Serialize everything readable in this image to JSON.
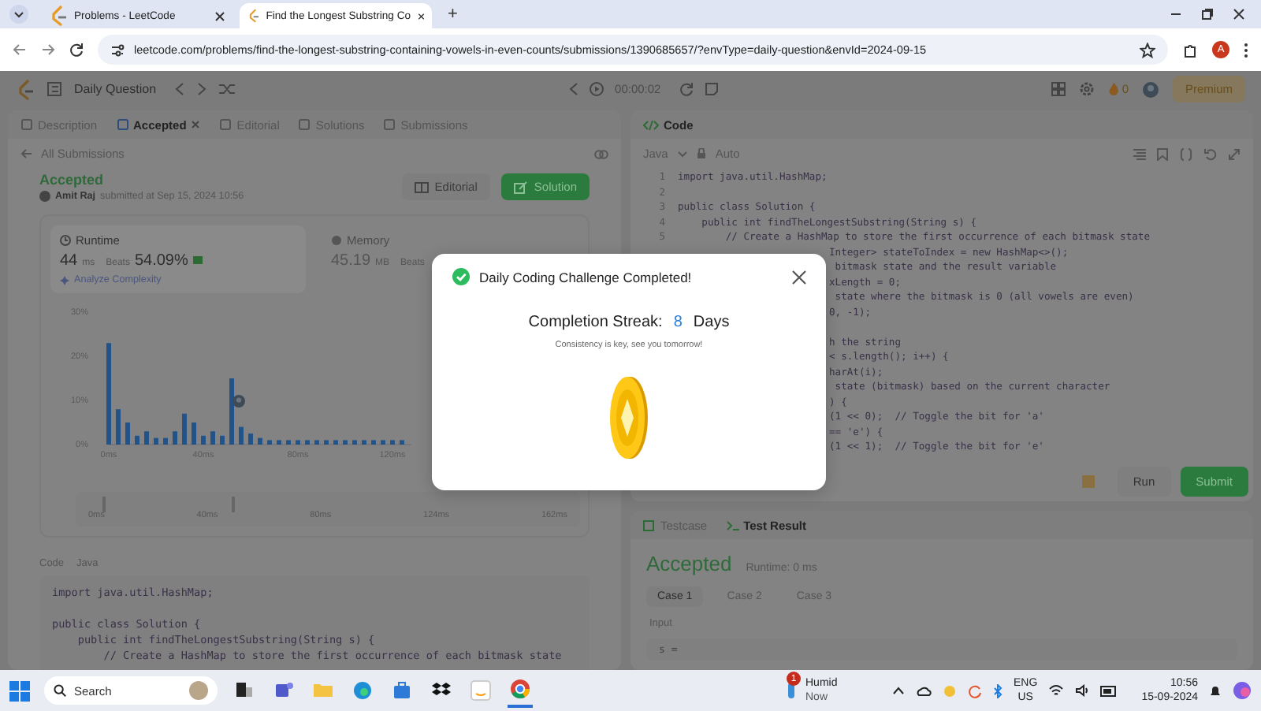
{
  "browser": {
    "tabs": [
      {
        "title": "Problems - LeetCode",
        "selected": false
      },
      {
        "title": "Find the Longest Substring Co",
        "selected": true
      }
    ],
    "new_tab": "+",
    "url": "leetcode.com/problems/find-the-longest-substring-containing-vowels-in-even-counts/submissions/1390685657/?envType=daily-question&envId=2024-09-15",
    "profile": "A"
  },
  "header": {
    "title": "Daily Question",
    "timer": "00:00:02",
    "coins": "0",
    "premium": "Premium"
  },
  "left_panel": {
    "tabs": [
      {
        "label": "Description",
        "selected": false
      },
      {
        "label": "Accepted",
        "selected": true
      },
      {
        "label": "Editorial",
        "selected": false
      },
      {
        "label": "Solutions",
        "selected": false
      },
      {
        "label": "Submissions",
        "selected": false
      }
    ],
    "back_link": "All Submissions",
    "status": "Accepted",
    "author": "Amit Raj",
    "submitted": "submitted at Sep 15, 2024 10:56",
    "actions": [
      {
        "label": "Editorial",
        "kind": "plain"
      },
      {
        "label": "Solution",
        "kind": "primary"
      }
    ],
    "stats": [
      {
        "label": "Runtime",
        "value": "44",
        "unit": "ms",
        "beats_label": "Beats",
        "beats": "54.09%",
        "analyze": "Analyze Complexity",
        "selected": true
      },
      {
        "label": "Memory",
        "value": "45.19",
        "unit": "MB",
        "beats_label": "Beats",
        "selected": false
      }
    ],
    "chart_data": {
      "type": "bar",
      "x": [
        0,
        4,
        8,
        12,
        16,
        20,
        24,
        28,
        32,
        36,
        40,
        44,
        48,
        52,
        56,
        60,
        64,
        68,
        72,
        76,
        80,
        84,
        88,
        92,
        96,
        100,
        104,
        108,
        112,
        116,
        120,
        124
      ],
      "values": [
        23,
        8,
        5,
        2,
        3,
        1.5,
        1.5,
        3,
        7,
        5,
        2,
        3,
        2,
        15,
        4,
        2.5,
        1.5,
        1,
        1,
        1,
        1,
        1,
        1,
        1,
        1,
        1,
        1,
        1,
        1,
        1,
        1,
        1
      ],
      "xlim": [
        0,
        128
      ],
      "ylim": [
        0,
        30
      ],
      "xticks": [
        {
          "value": 0,
          "label": "0ms"
        },
        {
          "value": 40,
          "label": "40ms"
        },
        {
          "value": 80,
          "label": "80ms"
        },
        {
          "value": 120,
          "label": "120ms"
        }
      ],
      "yticks": [
        {
          "value": 0,
          "label": "0%"
        },
        {
          "value": 10,
          "label": "10%"
        },
        {
          "value": 20,
          "label": "20%"
        },
        {
          "value": 30,
          "label": "30%"
        }
      ]
    },
    "range_labels": [
      "0ms",
      "40ms",
      "80ms",
      "124ms",
      "162ms"
    ],
    "range_handles": [
      {
        "level": 0.03
      },
      {
        "level": 0.3
      }
    ],
    "code_label": "Code",
    "language": "Java",
    "code": [
      {
        "text": "import java.util.HashMap;",
        "blank_before": false
      },
      {
        "text": "public class Solution {",
        "blank_before": true
      },
      {
        "text": "    public int findTheLongestSubstring(String s) {",
        "blank_before": false
      },
      {
        "text": "        // Create a HashMap to store the first occurrence of each bitmask state",
        "blank_before": false
      }
    ]
  },
  "right_panel": {
    "tab": "Code",
    "language": "Java",
    "mode": "Auto",
    "lines": [
      {
        "number": "1",
        "text": "import java.util.HashMap;"
      },
      {
        "number": "2"
      },
      {
        "number": "3",
        "text": "public class Solution {"
      },
      {
        "number": "4",
        "text": "    public int findTheLongestSubstring(String s) {"
      },
      {
        "number": "5",
        "text": "        // Create a HashMap to store the first occurrence of each bitmask state"
      },
      {
        "text": "Integer> stateToIndex = new HashMap<>();"
      },
      {
        "text": " bitmask state and the result variable"
      },
      {
        "text": "xLength = 0;"
      },
      {
        "text": " state where the bitmask is 0 (all vowels are even)"
      },
      {
        "text": "0, -1);"
      },
      {
        "text": "h the string",
        "blank_before": true
      },
      {
        "text": "< s.length(); i++) {"
      },
      {
        "text": "harAt(i);"
      },
      {
        "text": " state (bitmask) based on the current character"
      },
      {
        "text": ") {"
      },
      {
        "text": "(1 << 0);  // Toggle the bit for 'a'"
      },
      {
        "text": "== 'e') {"
      },
      {
        "text": "(1 << 1);  // Toggle the bit for 'e'"
      }
    ],
    "run": "Run",
    "submit": "Submit",
    "result_tabs": [
      {
        "label": "Testcase",
        "selected": false
      },
      {
        "label": "Test Result",
        "selected": true
      }
    ],
    "verdict": "Accepted",
    "runtime": "Runtime: 0 ms",
    "cases": [
      {
        "label": "Case 1",
        "selected": true
      },
      {
        "label": "Case 2",
        "selected": false
      },
      {
        "label": "Case 3",
        "selected": false
      }
    ],
    "input_label": "Input",
    "input": "s ="
  },
  "modal": {
    "title": "Daily Coding Challenge Completed!",
    "streak_label": "Completion Streak:",
    "streak": "8",
    "streak_unit": "Days",
    "message": "Consistency is key, see you tomorrow!"
  },
  "taskbar": {
    "search": "Search",
    "apps": [
      {
        "kind": "widgets",
        "selected": false
      },
      {
        "kind": "teams",
        "selected": false
      },
      {
        "kind": "folder",
        "selected": false
      },
      {
        "kind": "edge",
        "selected": false
      },
      {
        "kind": "store",
        "selected": false
      },
      {
        "kind": "dropbox",
        "selected": false
      },
      {
        "kind": "amazon",
        "selected": false
      },
      {
        "kind": "chrome",
        "selected": true
      }
    ],
    "weather": {
      "badge": "1",
      "title": "Humid",
      "subtitle": "Now"
    },
    "language": "ENG",
    "region": "US",
    "time": "10:56",
    "date": "15-09-2024"
  }
}
